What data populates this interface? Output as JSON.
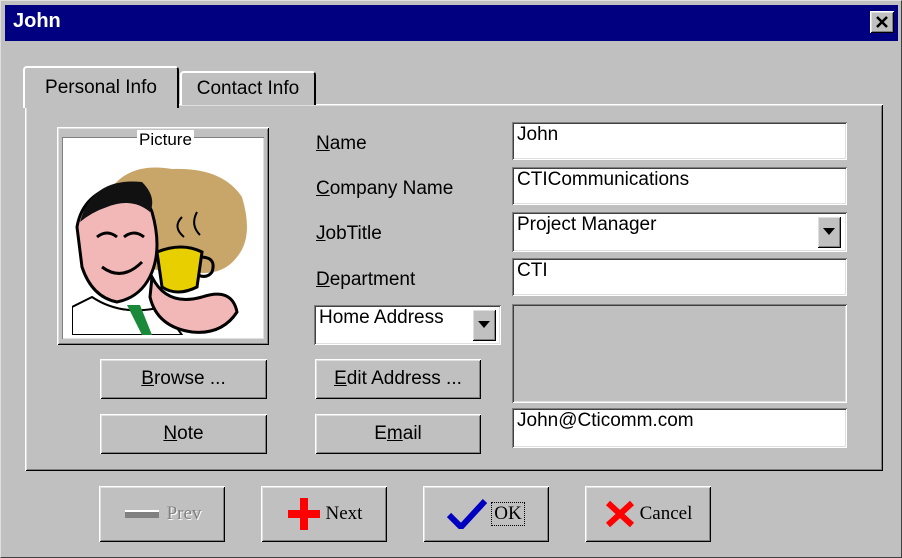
{
  "window": {
    "title": "John"
  },
  "tabs": [
    {
      "label": "Personal Info",
      "active": true
    },
    {
      "label": "Contact Info",
      "active": false
    }
  ],
  "picture": {
    "caption": "Picture"
  },
  "buttons": {
    "browse": {
      "pre": "",
      "accel": "B",
      "post": "rowse ..."
    },
    "note": {
      "pre": "",
      "accel": "N",
      "post": "ote"
    },
    "edit_address": {
      "pre": "",
      "accel": "E",
      "post": "dit Address ..."
    },
    "email": {
      "pre": "E",
      "accel": "m",
      "post": "ail"
    }
  },
  "fields": {
    "name": {
      "label_accel": "N",
      "label_rest": "ame",
      "value": "John"
    },
    "company": {
      "label_accel": "C",
      "label_rest": "ompany Name",
      "value": "CTICommunications"
    },
    "jobtitle": {
      "label_accel": "J",
      "label_rest": "obTitle",
      "value": "Project Manager"
    },
    "department": {
      "label_accel": "D",
      "label_rest": "epartment",
      "value": "CTI"
    },
    "address_type": {
      "value": "Home Address"
    },
    "email": {
      "value": "John@Cticomm.com"
    }
  },
  "nav": {
    "prev": "Prev",
    "next": "Next",
    "ok": "OK",
    "cancel": "Cancel"
  },
  "colors": {
    "titlebar": "#000080",
    "face": "#c0c0c0",
    "next_plus": "#ff0000",
    "cancel_x": "#ff0000",
    "ok_check": "#0000c0"
  },
  "icons": [
    "close-icon",
    "dropdown-arrow-icon",
    "prev-arrow-icon",
    "plus-icon",
    "checkmark-icon",
    "x-icon"
  ]
}
